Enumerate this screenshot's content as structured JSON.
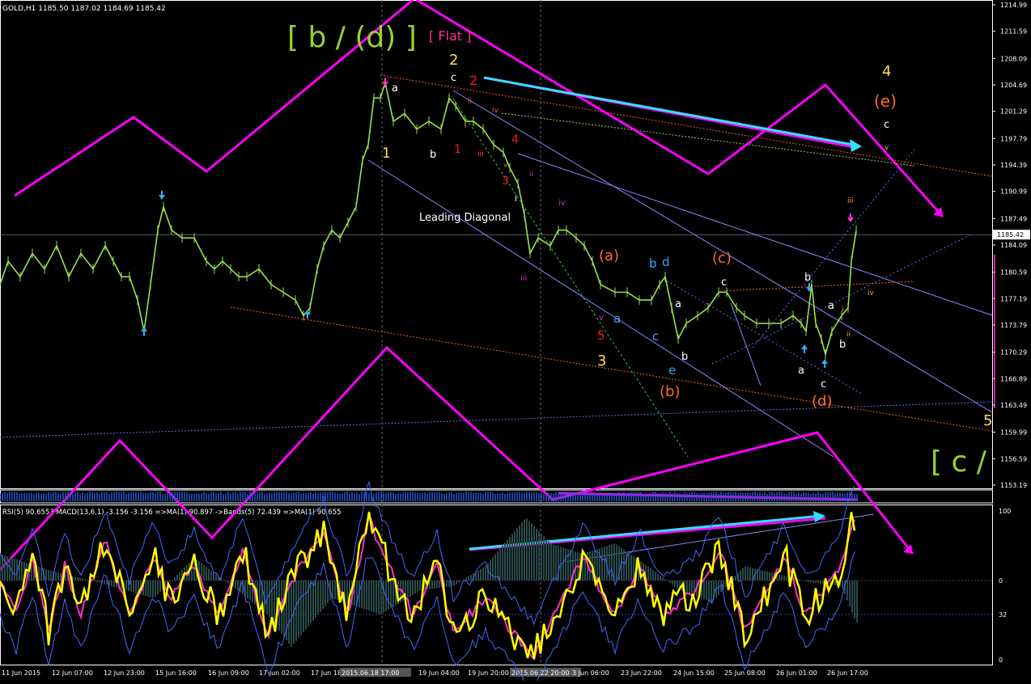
{
  "window": {
    "symbol_header": "GOLD,H1",
    "ohlc": [
      "1185.50",
      "1187.02",
      "1184.69",
      "1185.42"
    ]
  },
  "chart_data": {
    "type": "line",
    "instrument": "GOLD",
    "timeframe": "H1",
    "ylim": [
      1153.19,
      1214.99
    ],
    "price_ticks": [
      "1214.99",
      "1211.59",
      "1208.09",
      "1204.69",
      "1201.29",
      "1197.79",
      "1194.39",
      "1190.99",
      "1187.49",
      "1184.09",
      "1180.59",
      "1177.19",
      "1173.79",
      "1170.29",
      "1166.89",
      "1163.49",
      "1159.99",
      "1156.59",
      "1153.19"
    ],
    "current_price": "1185.42",
    "time_labels": [
      "11 Jun 2015",
      "12 Jun 07:00",
      "12 Jun 23:00",
      "15 Jun 16:00",
      "16 Jun 09:00",
      "17 Jun 02:00",
      "17 Jun 18:00",
      "2015.06.18 17:00",
      "19 Jun 04:00",
      "19 Jun 20:00",
      "2015.06.22 20:00",
      "3 Jun 06:00",
      "23 Jun 22:00",
      "24 Jun 15:00",
      "25 Jun 08:00",
      "26 Jun 01:00",
      "26 Jun 17:00"
    ],
    "price_path": [
      [
        0,
        1179
      ],
      [
        10,
        1182
      ],
      [
        25,
        1180
      ],
      [
        40,
        1183
      ],
      [
        55,
        1181
      ],
      [
        70,
        1184
      ],
      [
        85,
        1180
      ],
      [
        100,
        1183
      ],
      [
        115,
        1181
      ],
      [
        130,
        1184
      ],
      [
        140,
        1182
      ],
      [
        150,
        1180
      ],
      [
        160,
        1180
      ],
      [
        170,
        1177
      ],
      [
        178,
        1173
      ],
      [
        186,
        1179
      ],
      [
        195,
        1186
      ],
      [
        202,
        1189
      ],
      [
        212,
        1186
      ],
      [
        225,
        1185
      ],
      [
        240,
        1185
      ],
      [
        255,
        1182
      ],
      [
        265,
        1181
      ],
      [
        275,
        1182
      ],
      [
        285,
        1181
      ],
      [
        295,
        1180
      ],
      [
        305,
        1180
      ],
      [
        320,
        1181
      ],
      [
        335,
        1179
      ],
      [
        350,
        1178
      ],
      [
        365,
        1177
      ],
      [
        375,
        1175
      ],
      [
        383,
        1176
      ],
      [
        392,
        1181
      ],
      [
        400,
        1184
      ],
      [
        410,
        1186
      ],
      [
        420,
        1185
      ],
      [
        430,
        1187
      ],
      [
        440,
        1189
      ],
      [
        448,
        1195
      ],
      [
        455,
        1197
      ],
      [
        462,
        1203
      ],
      [
        470,
        1203
      ],
      [
        476,
        1205
      ],
      [
        486,
        1200
      ],
      [
        500,
        1201
      ],
      [
        515,
        1199
      ],
      [
        530,
        1200
      ],
      [
        545,
        1199
      ],
      [
        555,
        1203
      ],
      [
        563,
        1202
      ],
      [
        575,
        1200
      ],
      [
        585,
        1200
      ],
      [
        597,
        1199
      ],
      [
        610,
        1197
      ],
      [
        622,
        1196
      ],
      [
        630,
        1194
      ],
      [
        640,
        1192
      ],
      [
        648,
        1188
      ],
      [
        655,
        1183
      ],
      [
        665,
        1185
      ],
      [
        680,
        1184
      ],
      [
        690,
        1186
      ],
      [
        700,
        1186
      ],
      [
        712,
        1185
      ],
      [
        722,
        1184
      ],
      [
        732,
        1182
      ],
      [
        742,
        1179
      ],
      [
        760,
        1178
      ],
      [
        775,
        1178
      ],
      [
        790,
        1177
      ],
      [
        805,
        1177
      ],
      [
        815,
        1179
      ],
      [
        822,
        1180
      ],
      [
        830,
        1176
      ],
      [
        838,
        1172
      ],
      [
        848,
        1174
      ],
      [
        862,
        1175
      ],
      [
        875,
        1176
      ],
      [
        888,
        1178
      ],
      [
        898,
        1178
      ],
      [
        910,
        1176
      ],
      [
        920,
        1175
      ],
      [
        935,
        1174
      ],
      [
        950,
        1174
      ],
      [
        965,
        1174
      ],
      [
        980,
        1175
      ],
      [
        990,
        1174
      ],
      [
        996,
        1173
      ],
      [
        1003,
        1179
      ],
      [
        1008,
        1174
      ],
      [
        1015,
        1172
      ],
      [
        1020,
        1170
      ],
      [
        1028,
        1173
      ],
      [
        1040,
        1175
      ],
      [
        1048,
        1176
      ],
      [
        1052,
        1182
      ],
      [
        1058,
        1186
      ]
    ],
    "price_line_color": "#9ae04f",
    "wave_labels": [
      {
        "text": "[ b / (d) ]",
        "color": "#9acd32"
      },
      {
        "text": "[ Flat ]",
        "color": "#ff3399"
      },
      {
        "text": "2",
        "color": "#ffe14d"
      },
      {
        "text": "c",
        "color": "#ffffff"
      },
      {
        "text": "2",
        "color": "#ff1a1a"
      },
      {
        "text": "a",
        "color": "#ffffff"
      },
      {
        "text": "1",
        "color": "#ffe14d"
      },
      {
        "text": "b",
        "color": "#ffffff"
      },
      {
        "text": "1",
        "color": "#ff1a1a"
      },
      {
        "text": "i",
        "color": "#ff5050"
      },
      {
        "text": "ii",
        "color": "#ff5050"
      },
      {
        "text": "iii",
        "color": "#ff5050"
      },
      {
        "text": "iv",
        "color": "#ff5050"
      },
      {
        "text": "v",
        "color": "#ff5050"
      },
      {
        "text": "4",
        "color": "#ff1a1a"
      },
      {
        "text": "3",
        "color": "#ff1a1a"
      },
      {
        "text": "i",
        "color": "#ffffff"
      },
      {
        "text": "ii",
        "color": "#cc33cc"
      },
      {
        "text": "iii",
        "color": "#cc33cc"
      },
      {
        "text": "iv",
        "color": "#cc33cc"
      },
      {
        "text": "v",
        "color": "#cc33cc"
      },
      {
        "text": "Leading Diagonal",
        "color": "#ffffff"
      },
      {
        "text": "(a)",
        "color": "#ff6a2a"
      },
      {
        "text": "b",
        "color": "#33aaff"
      },
      {
        "text": "d",
        "color": "#33aaff"
      },
      {
        "text": "(c)",
        "color": "#ff6a2a"
      },
      {
        "text": "a",
        "color": "#33aaff"
      },
      {
        "text": "c",
        "color": "#33aaff"
      },
      {
        "text": "e",
        "color": "#33aaff"
      },
      {
        "text": "5",
        "color": "#ff1a1a"
      },
      {
        "text": "3",
        "color": "#ffe14d"
      },
      {
        "text": "(b)",
        "color": "#ff6a2a"
      },
      {
        "text": "a",
        "color": "#ffffff"
      },
      {
        "text": "b",
        "color": "#ffffff"
      },
      {
        "text": "c",
        "color": "#ffffff"
      },
      {
        "text": "b",
        "color": "#ffffff"
      },
      {
        "text": "a",
        "color": "#ffffff"
      },
      {
        "text": "a",
        "color": "#ffffff"
      },
      {
        "text": "c",
        "color": "#ffffff"
      },
      {
        "text": "(d)",
        "color": "#ff6a2a"
      },
      {
        "text": "b",
        "color": "#ffffff"
      },
      {
        "text": "i",
        "color": "#ff9944"
      },
      {
        "text": "ii",
        "color": "#ff9944"
      },
      {
        "text": "iii",
        "color": "#ff9944"
      },
      {
        "text": "iv",
        "color": "#ff9944"
      },
      {
        "text": "v",
        "color": "#ff9944"
      },
      {
        "text": "4",
        "color": "#ffe14d"
      },
      {
        "text": "(e)",
        "color": "#ff6a2a"
      },
      {
        "text": "c",
        "color": "#ffffff"
      },
      {
        "text": "5",
        "color": "#ffe14d"
      },
      {
        "text": "[ c /",
        "color": "#9acd32"
      }
    ],
    "oscillator": {
      "header": "RSI(5) 90.6553  MACD(13,6,1) -3.156 -3.156  =>MA(1) 90.897  ->Bands(5) 72.439  =>MA(1) 90.655",
      "levels": [
        "100",
        "0",
        "32",
        "0"
      ],
      "rsi_color": "#ffff00",
      "ma_color": "#ff33cc",
      "bands_color": "#4466ff"
    },
    "colors": {
      "zigzag": "#ff00ff",
      "arrow": "#33e0ff",
      "channel": "#6a6aff",
      "trendline": "#ff5a1a",
      "grid": "#1a1a1a",
      "axis_text": "#ffffff"
    }
  }
}
